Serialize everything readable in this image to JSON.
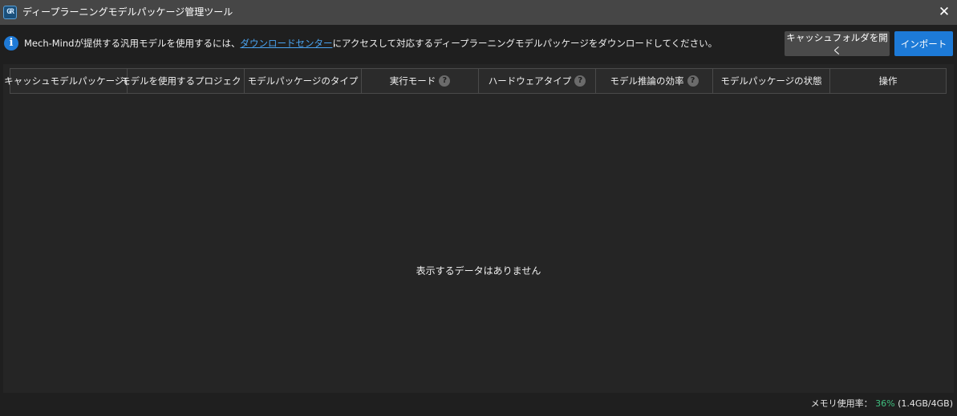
{
  "window": {
    "title": "ディープラーニングモデルパッケージ管理ツール",
    "app_icon_text": "GR",
    "close_glyph": "✕"
  },
  "infobar": {
    "icon_glyph": "i",
    "text_before_link": "Mech-Mindが提供する汎用モデルを使用するには、",
    "link_text": "ダウンロードセンター",
    "text_after_link": "にアクセスして対応するディープラーニングモデルパッケージをダウンロードしてください。",
    "open_cache_button": "キャッシュフォルダを開く",
    "import_button": "インポート"
  },
  "table": {
    "columns": [
      {
        "label": "キャッシュモデルパッケージ名",
        "help": false
      },
      {
        "label": "モデルを使用するプロジェクト",
        "help": false
      },
      {
        "label": "モデルパッケージのタイプ",
        "help": false
      },
      {
        "label": "実行モード",
        "help": true
      },
      {
        "label": "ハードウェアタイプ",
        "help": true
      },
      {
        "label": "モデル推論の効率",
        "help": true
      },
      {
        "label": "モデルパッケージの状態",
        "help": false
      },
      {
        "label": "操作",
        "help": false
      }
    ],
    "help_glyph": "?",
    "empty_message": "表示するデータはありません"
  },
  "status": {
    "memory_label": "メモリ使用率：",
    "memory_percent": "36%",
    "memory_detail": "(1.4GB/4GB)",
    "memory_percent_color": "#3fbf7f"
  },
  "colors": {
    "titlebar": "#464646",
    "accent": "#1d7ad7",
    "link": "#4aa3f0"
  }
}
